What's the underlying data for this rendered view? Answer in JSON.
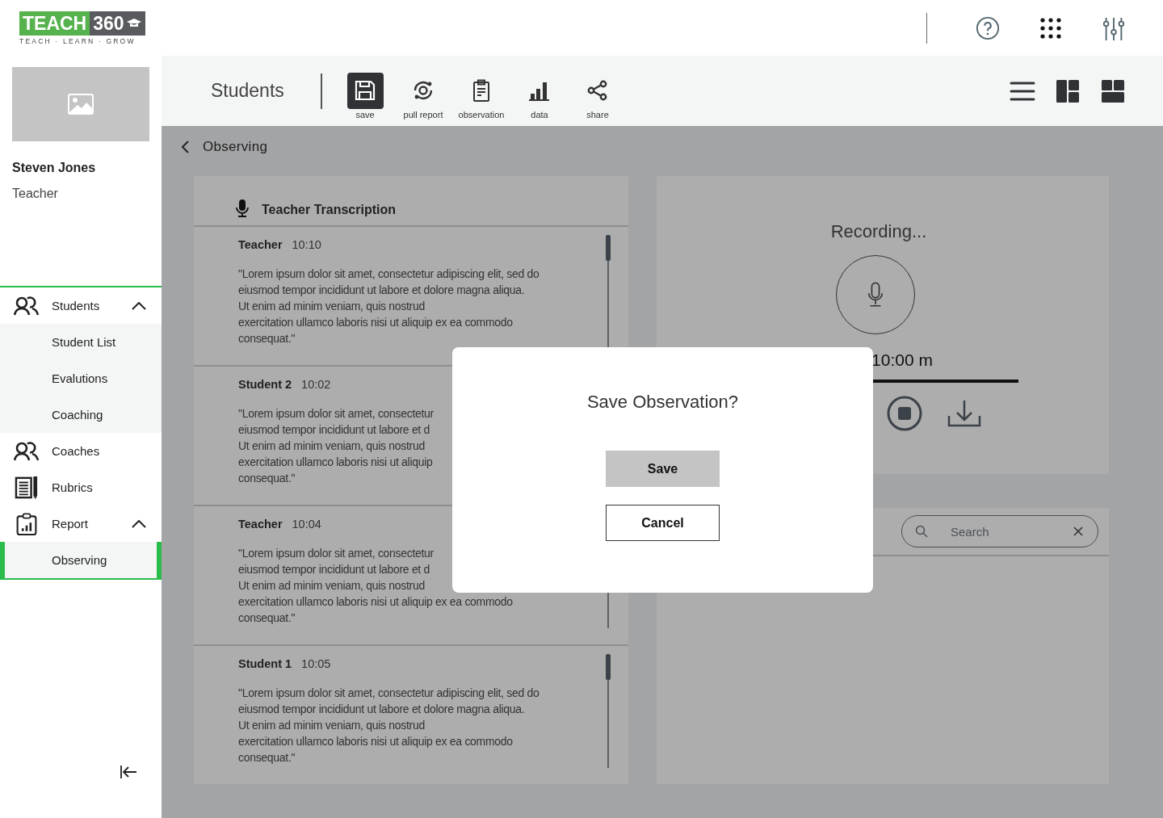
{
  "logo": {
    "main": "TEACH",
    "accent": "360",
    "tagline": "TEACH · LEARN · GROW"
  },
  "profile": {
    "name": "Steven Jones",
    "role": "Teacher"
  },
  "nav": [
    {
      "label": "Students",
      "selected": false,
      "expanded": true,
      "children": [
        {
          "label": "Student List",
          "selected": false
        },
        {
          "label": "Evalutions",
          "selected": false
        },
        {
          "label": "Coaching",
          "selected": false
        }
      ]
    },
    {
      "label": "Coaches",
      "selected": false
    },
    {
      "label": "Rubrics",
      "selected": false
    },
    {
      "label": "Report",
      "selected": false,
      "expanded": true,
      "children": [
        {
          "label": "Observing",
          "selected": true
        }
      ]
    }
  ],
  "toolbar": {
    "title": "Students",
    "actions": [
      {
        "label": "save",
        "selected": true
      },
      {
        "label": "pull report",
        "selected": false
      },
      {
        "label": "observation",
        "selected": false
      },
      {
        "label": "data",
        "selected": false
      },
      {
        "label": "share",
        "selected": false
      }
    ]
  },
  "breadcrumb": "Observing",
  "transcription": {
    "title": "Teacher Transcription",
    "entries": [
      {
        "speaker": "Teacher",
        "time": "10:10",
        "scrollbar": true,
        "lines": [
          "\"Lorem ipsum dolor sit amet, consectetur adipiscing elit, sed do",
          "eiusmod tempor incididunt ut labore et dolore magna aliqua.",
          "Ut enim ad minim veniam, quis nostrud",
          "exercitation ullamco laboris nisi ut aliquip ex ea commodo",
          "consequat.\""
        ]
      },
      {
        "speaker": "Student 2",
        "time": "10:02",
        "scrollbar": false,
        "lines": [
          "\"Lorem ipsum dolor sit amet, consectetur",
          "eiusmod tempor incididunt ut labore et d",
          "Ut enim ad minim veniam, quis nostrud",
          "exercitation ullamco laboris nisi ut aliquip",
          "consequat.\""
        ]
      },
      {
        "speaker": "Teacher",
        "time": "10:04",
        "scrollbar": true,
        "lines": [
          "\"Lorem ipsum dolor sit amet, consectetur",
          "eiusmod tempor incididunt ut labore et d",
          "Ut enim ad minim veniam, quis nostrud",
          "exercitation ullamco laboris nisi ut aliquip ex ea commodo",
          "consequat.\""
        ]
      },
      {
        "speaker": "Student 1",
        "time": "10:05",
        "scrollbar": true,
        "lines": [
          "\"Lorem ipsum dolor sit amet, consectetur adipiscing elit, sed do",
          "eiusmod tempor incididunt ut labore et dolore magna aliqua.",
          "Ut enim ad minim veniam, quis nostrud",
          "exercitation ullamco laboris nisi ut aliquip ex ea commodo",
          "consequat.\""
        ]
      }
    ]
  },
  "recorder": {
    "status": "Recording...",
    "timer": "10:00 m"
  },
  "search": {
    "placeholder": "Search"
  },
  "dialog": {
    "title": "Save Observation?",
    "buttons": [
      {
        "label": "Save",
        "kind": "primary"
      },
      {
        "label": "Cancel",
        "kind": "secondary"
      }
    ]
  }
}
